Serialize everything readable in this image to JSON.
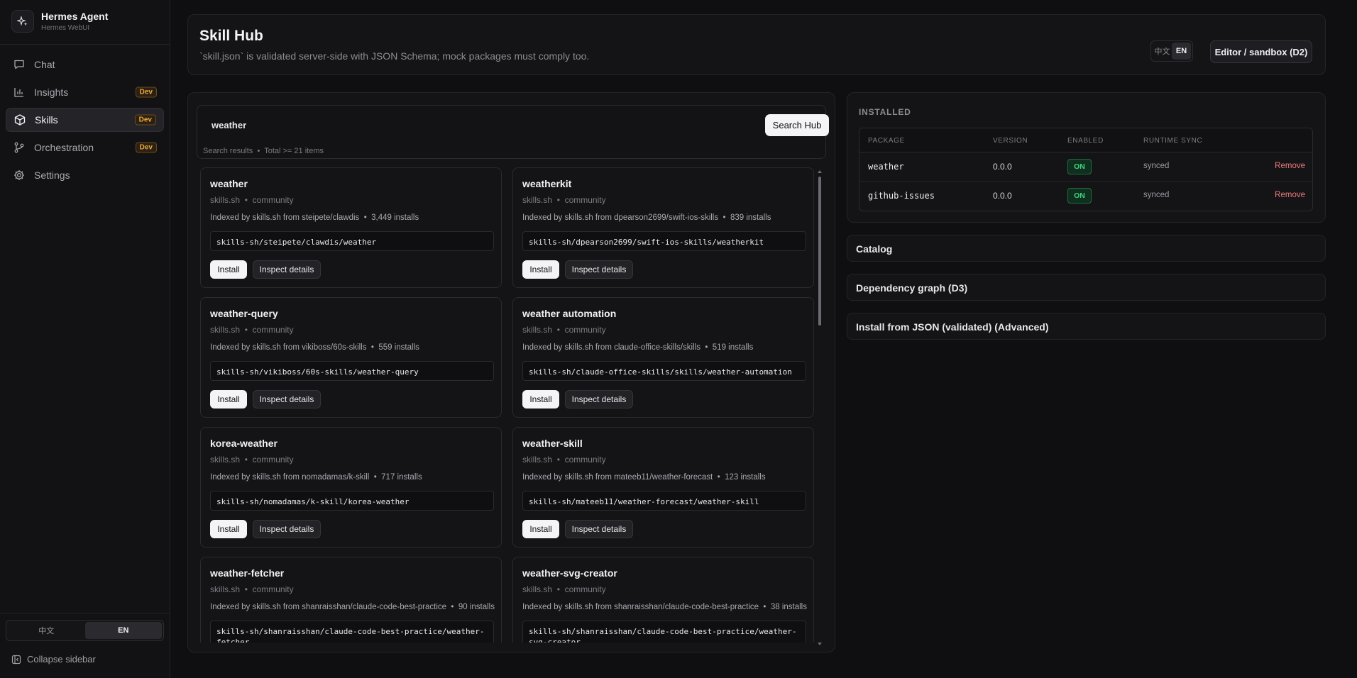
{
  "app": {
    "title": "Hermes Agent",
    "subtitle": "Hermes WebUI"
  },
  "sidebar": {
    "items": [
      {
        "label": "Chat",
        "icon": "chat-icon",
        "badge": ""
      },
      {
        "label": "Insights",
        "icon": "chart-icon",
        "badge": "Dev"
      },
      {
        "label": "Skills",
        "icon": "cube-icon",
        "badge": "Dev",
        "active": true
      },
      {
        "label": "Orchestration",
        "icon": "branch-icon",
        "badge": "Dev"
      },
      {
        "label": "Settings",
        "icon": "gear-icon",
        "badge": ""
      }
    ],
    "lang": {
      "zh": "中文",
      "en": "EN",
      "selected": "EN"
    },
    "collapse_label": "Collapse sidebar"
  },
  "header": {
    "title": "Skill Hub",
    "subtitle": "`skill.json` is validated server-side with JSON Schema; mock packages must comply too.",
    "lang": {
      "zh": "中文",
      "en": "EN",
      "selected": "EN"
    },
    "editor_button": "Editor / sandbox (D2)"
  },
  "search": {
    "query": "weather",
    "button": "Search Hub",
    "results_label": "Search results",
    "separator": "•",
    "total_label": "Total >= 21 items"
  },
  "results": [
    {
      "name": "weather",
      "source": "skills.sh",
      "tier": "community",
      "indexed": "Indexed by skills.sh from steipete/clawdis",
      "installs": "3,449 installs",
      "id": "skills-sh/steipete/clawdis/weather"
    },
    {
      "name": "weatherkit",
      "source": "skills.sh",
      "tier": "community",
      "indexed": "Indexed by skills.sh from dpearson2699/swift-ios-skills",
      "installs": "839 installs",
      "id": "skills-sh/dpearson2699/swift-ios-skills/weatherkit"
    },
    {
      "name": "weather-query",
      "source": "skills.sh",
      "tier": "community",
      "indexed": "Indexed by skills.sh from vikiboss/60s-skills",
      "installs": "559 installs",
      "id": "skills-sh/vikiboss/60s-skills/weather-query"
    },
    {
      "name": "weather automation",
      "source": "skills.sh",
      "tier": "community",
      "indexed": "Indexed by skills.sh from claude-office-skills/skills",
      "installs": "519 installs",
      "id": "skills-sh/claude-office-skills/skills/weather-automation"
    },
    {
      "name": "korea-weather",
      "source": "skills.sh",
      "tier": "community",
      "indexed": "Indexed by skills.sh from nomadamas/k-skill",
      "installs": "717 installs",
      "id": "skills-sh/nomadamas/k-skill/korea-weather"
    },
    {
      "name": "weather-skill",
      "source": "skills.sh",
      "tier": "community",
      "indexed": "Indexed by skills.sh from mateeb11/weather-forecast",
      "installs": "123 installs",
      "id": "skills-sh/mateeb11/weather-forecast/weather-skill"
    },
    {
      "name": "weather-fetcher",
      "source": "skills.sh",
      "tier": "community",
      "indexed": "Indexed by skills.sh from shanraisshan/claude-code-best-practice",
      "installs": "90 installs",
      "id": "skills-sh/shanraisshan/claude-code-best-practice/weather-fetcher"
    },
    {
      "name": "weather-svg-creator",
      "source": "skills.sh",
      "tier": "community",
      "indexed": "Indexed by skills.sh from shanraisshan/claude-code-best-practice",
      "installs": "38 installs",
      "id": "skills-sh/shanraisshan/claude-code-best-practice/weather-svg-creator"
    }
  ],
  "card_actions": {
    "install": "Install",
    "inspect": "Inspect details",
    "separator": "•"
  },
  "installed": {
    "title": "INSTALLED",
    "columns": [
      "PACKAGE",
      "VERSION",
      "ENABLED",
      "RUNTIME SYNC"
    ],
    "rows": [
      {
        "package": "weather",
        "version": "0.0.0",
        "enabled": "ON",
        "sync": "synced",
        "action": "Remove"
      },
      {
        "package": "github-issues",
        "version": "0.0.0",
        "enabled": "ON",
        "sync": "synced",
        "action": "Remove"
      }
    ]
  },
  "sections": [
    {
      "label": "Catalog"
    },
    {
      "label": "Dependency graph (D3)"
    },
    {
      "label": "Install from JSON (validated) (Advanced)"
    }
  ],
  "colors": {
    "accent_on": "#3fd47a",
    "badge_dev": "#f0a63a",
    "remove": "#ef7b7b"
  }
}
